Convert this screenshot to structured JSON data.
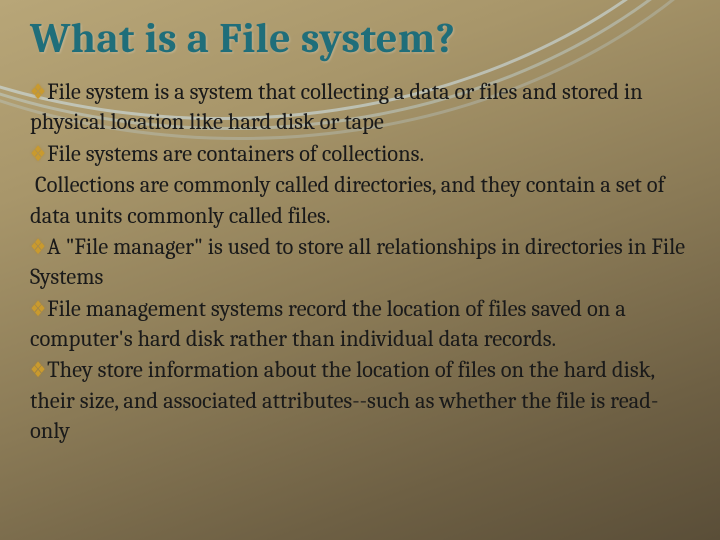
{
  "slide": {
    "title": "What is a File system?",
    "bullets": [
      {
        "text": "File system is a system that collecting a data or files and stored in physical location like hard disk or tape"
      },
      {
        "text": "File systems are containers of collections."
      },
      {
        "continuation": "Collections are commonly called directories, and they contain a set of data units commonly called files."
      },
      {
        "text": "A \"File manager\" is used to store all relationships in directories in File Systems"
      },
      {
        "text": "File management systems record the location of files saved on a computer's hard disk rather than individual data records."
      },
      {
        "text": "They store information about the location of files on the hard disk, their size, and associated attributes--such as whether the file is read-only"
      }
    ],
    "bullet_icon": "❖"
  }
}
